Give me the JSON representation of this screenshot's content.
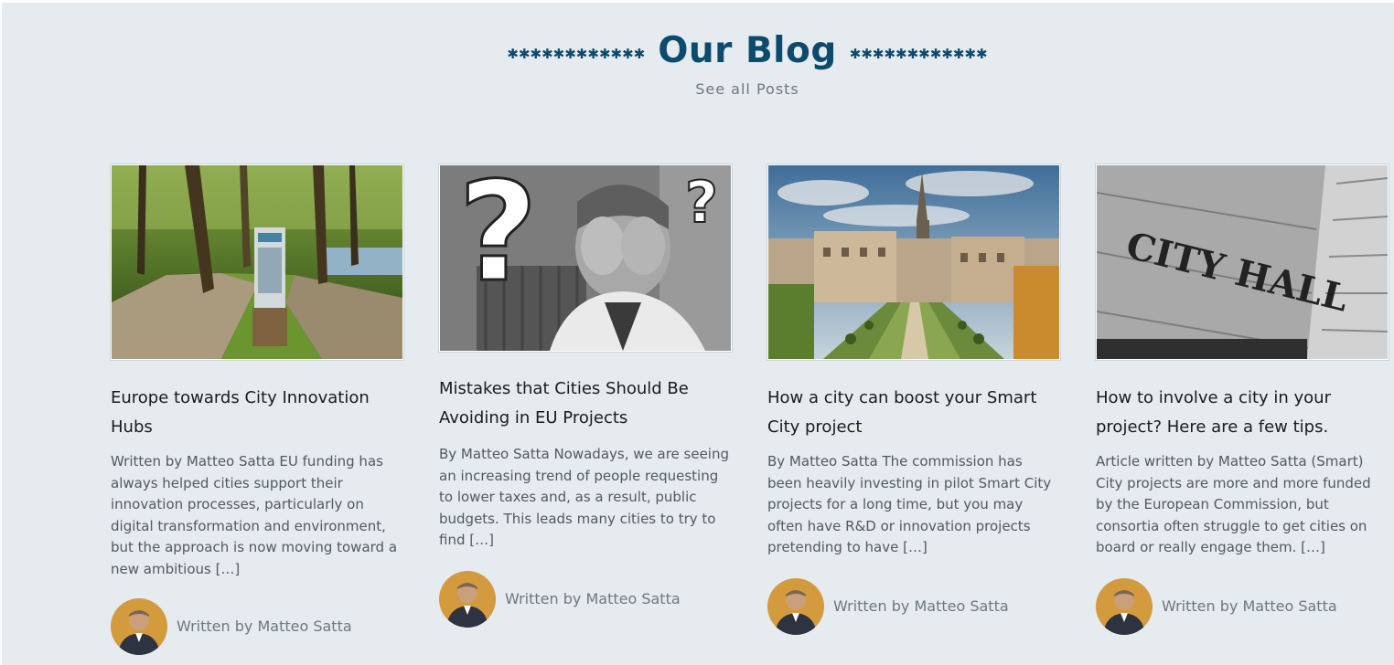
{
  "blog": {
    "title": "Our Blog",
    "title_decoration": "✱✱✱✱✱✱✱✱✱✱✱✱",
    "see_all_label": "See all Posts"
  },
  "colors": {
    "accent": "#0c4a6e",
    "background": "#e5ebee",
    "text": "#1b1b1b",
    "muted": "#6d7880"
  },
  "posts": [
    {
      "title": "Europe towards City Innovation Hubs",
      "excerpt": "Written by Matteo Satta EU funding has always helped cities support their innovation processes, particularly on digital transformation and environment, but the approach is now moving toward a new ambitious […]",
      "author": "Written by Matteo Satta",
      "image_icon": "park-path-photo"
    },
    {
      "title": "Mistakes that Cities Should Be Avoiding in EU Projects",
      "excerpt": "By Matteo Satta Nowadays, we are seeing an increasing trend of people requesting to lower taxes and, as a result, public budgets. This leads many cities to try to find […]",
      "author": "Written by Matteo Satta",
      "image_icon": "question-marks-photo"
    },
    {
      "title": "How a city can boost your Smart City project",
      "excerpt": "By Matteo Satta The commission has been heavily investing in pilot Smart City projects for a long time, but you may often have R&D or innovation projects pretending to have […]",
      "author": "Written by Matteo Satta",
      "image_icon": "cityscape-photo"
    },
    {
      "title": "How to involve a city in your project? Here are a few tips.",
      "excerpt": "Article written by Matteo Satta (Smart) City projects are more and more funded by the European Commission, but consortia often struggle to get cities on board or really engage them. […]",
      "author": "Written by Matteo Satta",
      "image_icon": "city-hall-photo",
      "image_text": "CITY HALL"
    }
  ]
}
